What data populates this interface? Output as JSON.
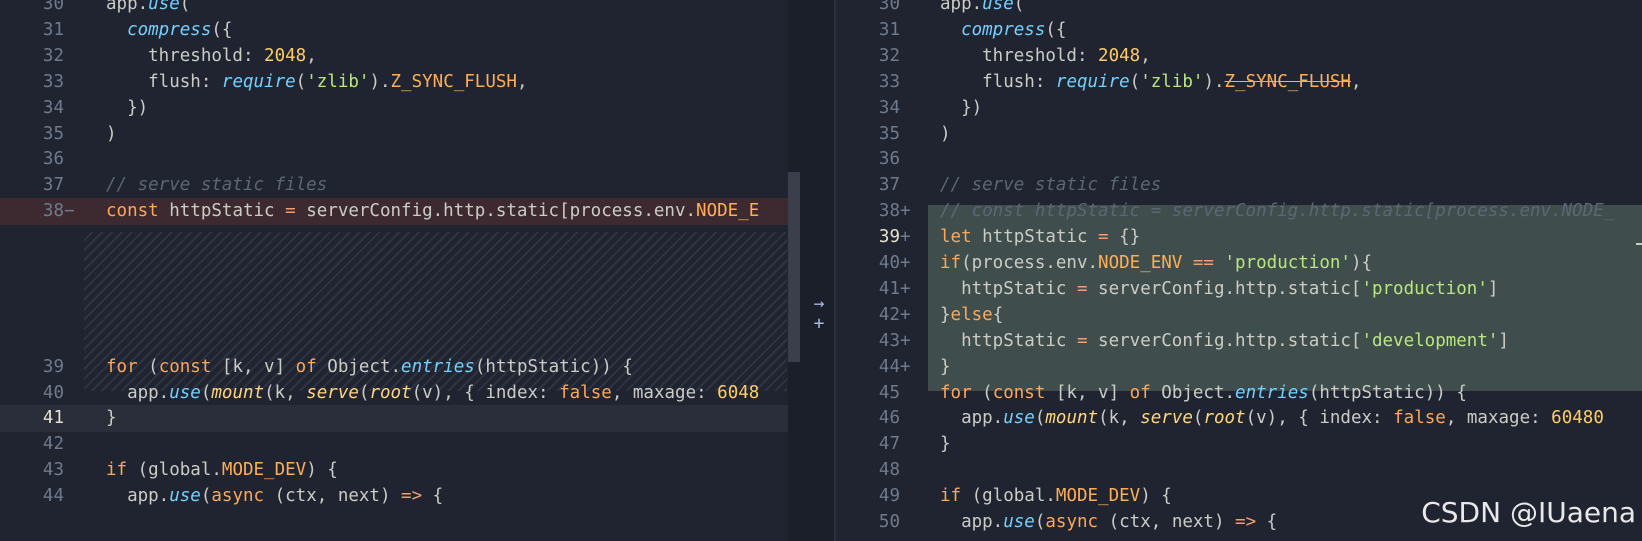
{
  "left": {
    "lines": [
      {
        "num": "30",
        "code": "app.use("
      },
      {
        "num": "31",
        "code": "  compress({"
      },
      {
        "num": "32",
        "code": "    threshold: 2048,"
      },
      {
        "num": "33",
        "code": "    flush: require('zlib').Z_SYNC_FLUSH,"
      },
      {
        "num": "34",
        "code": "  })"
      },
      {
        "num": "35",
        "code": ")"
      },
      {
        "num": "36",
        "code": ""
      },
      {
        "num": "37",
        "code": "// serve static files"
      },
      {
        "num": "38",
        "code": "const httpStatic = serverConfig.http.static[process.env.NODE_E"
      },
      {
        "num": "39",
        "code": "for (const [k, v] of Object.entries(httpStatic)) {"
      },
      {
        "num": "40",
        "code": "  app.use(mount(k, serve(root(v), { index: false, maxage: 6048"
      },
      {
        "num": "41",
        "code": "}"
      },
      {
        "num": "42",
        "code": ""
      },
      {
        "num": "43",
        "code": "if (global.MODE_DEV) {"
      },
      {
        "num": "44",
        "code": "  app.use(async (ctx, next) => {"
      }
    ]
  },
  "right": {
    "lines": [
      {
        "num": "30",
        "code": "app.use("
      },
      {
        "num": "31",
        "code": "  compress({"
      },
      {
        "num": "32",
        "code": "    threshold: 2048,"
      },
      {
        "num": "33",
        "code": "    flush: require('zlib').Z_SYNC_FLUSH,"
      },
      {
        "num": "34",
        "code": "  })"
      },
      {
        "num": "35",
        "code": ")"
      },
      {
        "num": "36",
        "code": ""
      },
      {
        "num": "37",
        "code": "// serve static files"
      },
      {
        "num": "38",
        "code": "// const httpStatic = serverConfig.http.static[process.env.NODE_"
      },
      {
        "num": "39",
        "code": "let httpStatic = {}"
      },
      {
        "num": "40",
        "code": "if(process.env.NODE_ENV == 'production'){"
      },
      {
        "num": "41",
        "code": "  httpStatic = serverConfig.http.static['production']"
      },
      {
        "num": "42",
        "code": "}else{"
      },
      {
        "num": "43",
        "code": "  httpStatic = serverConfig.http.static['development']"
      },
      {
        "num": "44",
        "code": "}"
      },
      {
        "num": "45",
        "code": "for (const [k, v] of Object.entries(httpStatic)) {"
      },
      {
        "num": "46",
        "code": "  app.use(mount(k, serve(root(v), { index: false, maxage: 60480"
      },
      {
        "num": "47",
        "code": "}"
      },
      {
        "num": "48",
        "code": ""
      },
      {
        "num": "49",
        "code": "if (global.MODE_DEV) {"
      },
      {
        "num": "50",
        "code": "  app.use(async (ctx, next) => {"
      }
    ]
  },
  "markers": {
    "deleted": "−",
    "added": "+"
  },
  "gap_buttons": {
    "revert": "→",
    "insert": "+"
  },
  "watermark": "CSDN @IUaena",
  "colors": {
    "background": "#1f2430",
    "added": "#3f4e4c",
    "deleted": "#3d2a31"
  },
  "icons": [
    "revert-arrow-icon",
    "plus-icon"
  ]
}
